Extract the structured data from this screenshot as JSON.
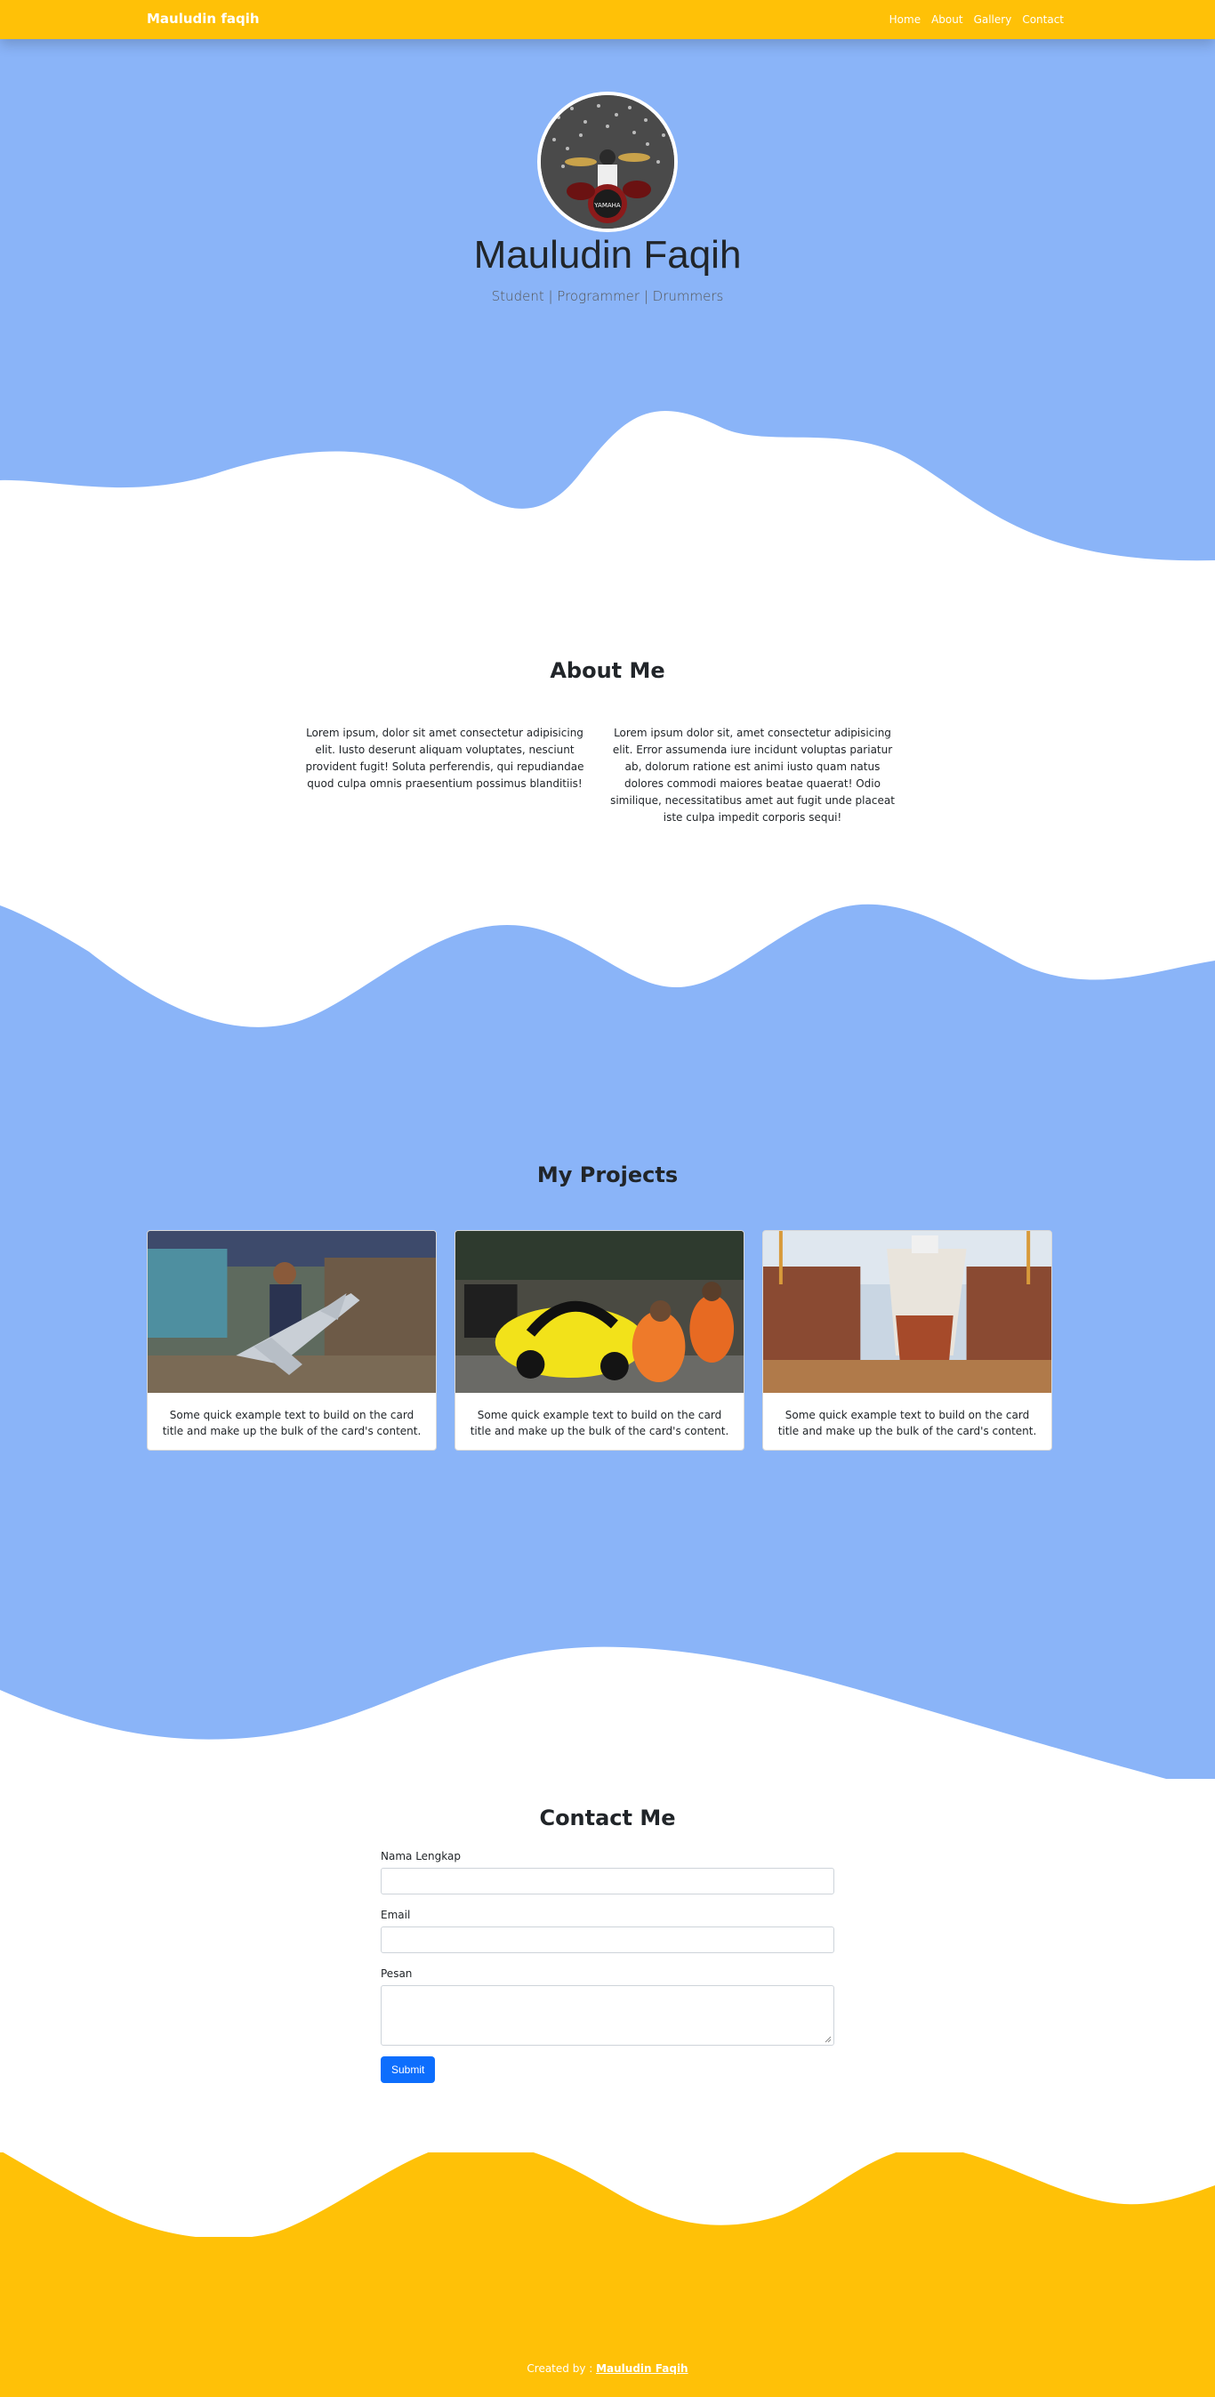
{
  "navbar": {
    "brand": "Mauludin faqih",
    "links": [
      "Home",
      "About",
      "Gallery",
      "Contact"
    ]
  },
  "hero": {
    "name": "Mauludin Faqih",
    "tagline": "Student | Programmer | Drummers"
  },
  "about": {
    "title": "About Me",
    "left": "Lorem ipsum, dolor sit amet consectetur adipisicing elit. Iusto deserunt aliquam voluptates, nesciunt provident fugit! Soluta perferendis, qui repudiandae quod culpa omnis praesentium possimus blanditiis!",
    "right": "Lorem ipsum dolor sit, amet consectetur adipisicing elit. Error assumenda iure incidunt voluptas pariatur ab, dolorum ratione est animi iusto quam natus dolores commodi maiores beatae quaerat! Odio similique, necessitatibus amet aut fugit unde placeat iste culpa impedit corporis sequi!"
  },
  "projects": {
    "title": "My Projects",
    "cards": [
      {
        "text": "Some quick example text to build on the card title and make up the bulk of the card's content."
      },
      {
        "text": "Some quick example text to build on the card title and make up the bulk of the card's content."
      },
      {
        "text": "Some quick example text to build on the card title and make up the bulk of the card's content."
      }
    ]
  },
  "contact": {
    "title": "Contact Me",
    "name_label": "Nama Lengkap",
    "email_label": "Email",
    "message_label": "Pesan",
    "submit_label": "Submit"
  },
  "footer": {
    "prefix": "Created by : ",
    "author": "Mauludin Faqih"
  },
  "colors": {
    "primary_blue": "#8ab4f8",
    "accent_yellow": "#ffc107",
    "button_blue": "#0d6efd"
  }
}
